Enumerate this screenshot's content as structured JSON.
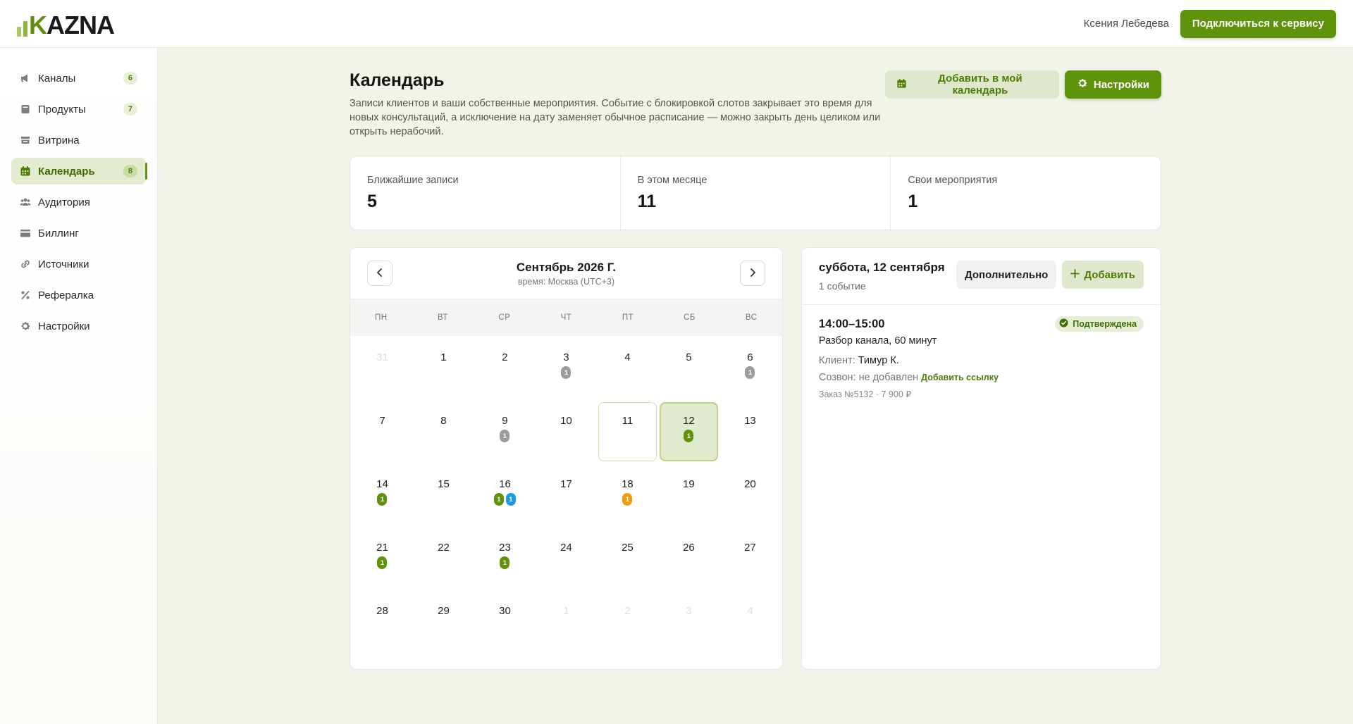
{
  "brand": {
    "logo_k": "K",
    "logo_rest": "AZNA",
    "accent": "#5f930b"
  },
  "header": {
    "user_name": "Ксения Лебедева",
    "connect_label": "Подключиться к сервису"
  },
  "sidebar": {
    "items": [
      {
        "label": "Каналы",
        "badge": "6",
        "icon": "megaphone-icon"
      },
      {
        "label": "Продукты",
        "badge": "7",
        "icon": "box-icon"
      },
      {
        "label": "Витрина",
        "badge": "",
        "icon": "storefront-icon"
      },
      {
        "label": "Календарь",
        "badge": "8",
        "icon": "calendar-icon",
        "active": true
      },
      {
        "label": "Аудитория",
        "badge": "",
        "icon": "users-icon"
      },
      {
        "label": "Биллинг",
        "badge": "",
        "icon": "credit-card-icon"
      },
      {
        "label": "Источники",
        "badge": "",
        "icon": "link-icon"
      },
      {
        "label": "Рефералка",
        "badge": "",
        "icon": "percent-icon"
      },
      {
        "label": "Настройки",
        "badge": "",
        "icon": "gear-icon"
      }
    ]
  },
  "page": {
    "title": "Календарь",
    "description": "Записи клиентов и ваши собственные мероприятия. Событие с блокировкой слотов закрывает это время для новых консультаций, а исключение на дату заменяет обычное расписание — можно закрыть день целиком или открыть нерабочий.",
    "add_calendar_label": "Добавить в мой календарь",
    "settings_label": "Настройки"
  },
  "stats": [
    {
      "label": "Ближайшие записи",
      "value": "5"
    },
    {
      "label": "В этом месяце",
      "value": "11"
    },
    {
      "label": "Свои мероприятия",
      "value": "1"
    }
  ],
  "calendar": {
    "title": "Сентябрь 2026 Г.",
    "timezone": "время: Москва (UTC+3)",
    "weekdays": [
      "ПН",
      "ВТ",
      "СР",
      "ЧТ",
      "ПТ",
      "СБ",
      "ВС"
    ],
    "days": [
      {
        "n": "31",
        "muted": true,
        "dots": []
      },
      {
        "n": "1",
        "dots": []
      },
      {
        "n": "2",
        "dots": []
      },
      {
        "n": "3",
        "dots": [
          {
            "c": "gray",
            "v": "1"
          }
        ]
      },
      {
        "n": "4",
        "dots": []
      },
      {
        "n": "5",
        "dots": []
      },
      {
        "n": "6",
        "dots": [
          {
            "c": "gray",
            "v": "1"
          }
        ]
      },
      {
        "n": "7",
        "dots": []
      },
      {
        "n": "8",
        "dots": []
      },
      {
        "n": "9",
        "dots": [
          {
            "c": "gray",
            "v": "1"
          }
        ]
      },
      {
        "n": "10",
        "dots": []
      },
      {
        "n": "11",
        "today": true,
        "dots": []
      },
      {
        "n": "12",
        "selected": true,
        "dots": [
          {
            "c": "green",
            "v": "1"
          }
        ]
      },
      {
        "n": "13",
        "dots": []
      },
      {
        "n": "14",
        "dots": [
          {
            "c": "green",
            "v": "1"
          }
        ]
      },
      {
        "n": "15",
        "dots": []
      },
      {
        "n": "16",
        "dots": [
          {
            "c": "green",
            "v": "1"
          },
          {
            "c": "blue",
            "v": "1"
          }
        ]
      },
      {
        "n": "17",
        "dots": []
      },
      {
        "n": "18",
        "dots": [
          {
            "c": "orange",
            "v": "1"
          }
        ]
      },
      {
        "n": "19",
        "dots": []
      },
      {
        "n": "20",
        "dots": []
      },
      {
        "n": "21",
        "dots": [
          {
            "c": "green",
            "v": "1"
          }
        ]
      },
      {
        "n": "22",
        "dots": []
      },
      {
        "n": "23",
        "dots": [
          {
            "c": "green",
            "v": "1"
          }
        ]
      },
      {
        "n": "24",
        "dots": []
      },
      {
        "n": "25",
        "dots": []
      },
      {
        "n": "26",
        "dots": []
      },
      {
        "n": "27",
        "dots": []
      },
      {
        "n": "28",
        "dots": []
      },
      {
        "n": "29",
        "dots": []
      },
      {
        "n": "30",
        "dots": []
      },
      {
        "n": "1",
        "muted": true,
        "dots": []
      },
      {
        "n": "2",
        "muted": true,
        "dots": []
      },
      {
        "n": "3",
        "muted": true,
        "dots": []
      },
      {
        "n": "4",
        "muted": true,
        "dots": []
      }
    ]
  },
  "day_panel": {
    "title": "суббота, 12 сентября",
    "count": "1 событие",
    "more_label": "Дополнительно",
    "add_label": "Добавить",
    "event": {
      "time": "14:00–15:00",
      "title": "Разбор канала, 60 минут",
      "status": "Подтверждена",
      "client_label": "Клиент:",
      "client_value": "Тимур К.",
      "call_text": "Созвон: не добавлен",
      "add_link": "Добавить ссылку",
      "order": "Заказ №5132 · 7 900 ₽"
    }
  }
}
